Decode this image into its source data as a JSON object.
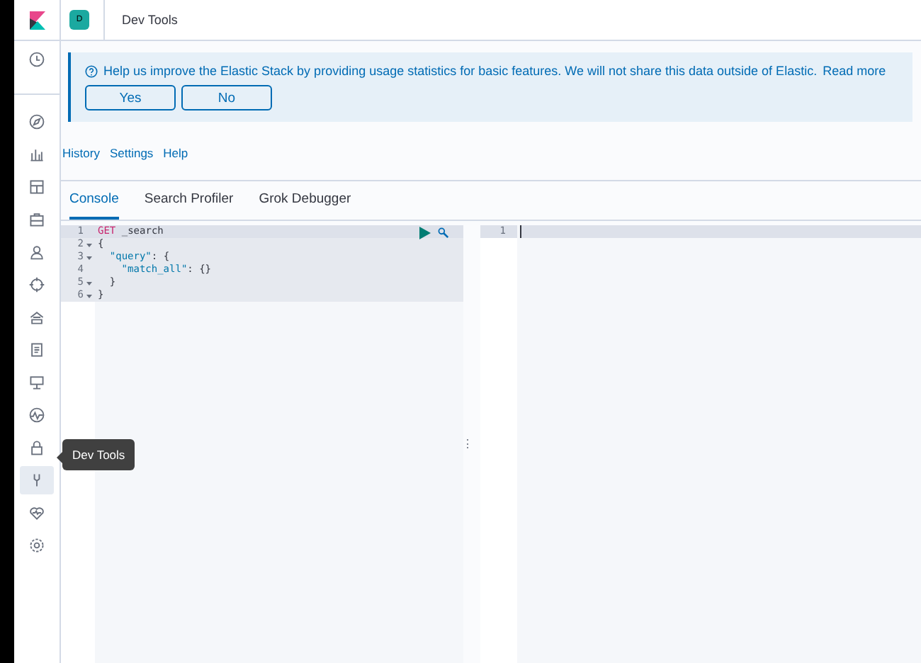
{
  "header": {
    "space_avatar": "D",
    "title": "Dev Tools"
  },
  "sidebar": {
    "items": [
      {
        "selected": false
      },
      {
        "selected": false
      },
      {
        "selected": false
      },
      {
        "selected": false
      },
      {
        "selected": false
      },
      {
        "selected": false
      },
      {
        "selected": false
      },
      {
        "selected": false
      },
      {
        "selected": false
      },
      {
        "selected": false
      },
      {
        "selected": false
      },
      {
        "selected": false
      },
      {
        "selected": true
      },
      {
        "selected": false
      },
      {
        "selected": false
      }
    ],
    "tooltip": "Dev Tools"
  },
  "callout": {
    "text": "Help us improve the Elastic Stack by providing usage statistics for basic features. We will not share this data outside of Elastic.",
    "link": "Read more",
    "buttons": [
      "Yes",
      "No"
    ]
  },
  "menu": [
    "History",
    "Settings",
    "Help"
  ],
  "tabs": [
    {
      "label": "Console",
      "selected": true
    },
    {
      "label": "Search Profiler",
      "selected": false
    },
    {
      "label": "Grok Debugger",
      "selected": false
    }
  ],
  "request_editor": {
    "lines": [
      {
        "number": "1",
        "fold": false,
        "tokens": [
          {
            "kind": "method",
            "text": "GET"
          },
          {
            "kind": "plain",
            "text": " _search"
          }
        ]
      },
      {
        "number": "2",
        "fold": true,
        "tokens": [
          {
            "kind": "plain",
            "text": "{"
          }
        ]
      },
      {
        "number": "3",
        "fold": true,
        "tokens": [
          {
            "kind": "key",
            "text": "\"query\""
          },
          {
            "kind": "plain",
            "text": ": {"
          }
        ]
      },
      {
        "number": "4",
        "fold": false,
        "tokens": [
          {
            "kind": "key",
            "text": "\"match_all\""
          },
          {
            "kind": "plain",
            "text": ": {}"
          }
        ]
      },
      {
        "number": "5",
        "fold": true,
        "tokens": [
          {
            "kind": "plain",
            "text": "}"
          }
        ]
      },
      {
        "number": "6",
        "fold": true,
        "tokens": [
          {
            "kind": "plain",
            "text": "}"
          }
        ]
      }
    ]
  },
  "resize_handle": "⋮",
  "response_editor": {
    "lines": [
      {
        "number": "1"
      }
    ]
  }
}
